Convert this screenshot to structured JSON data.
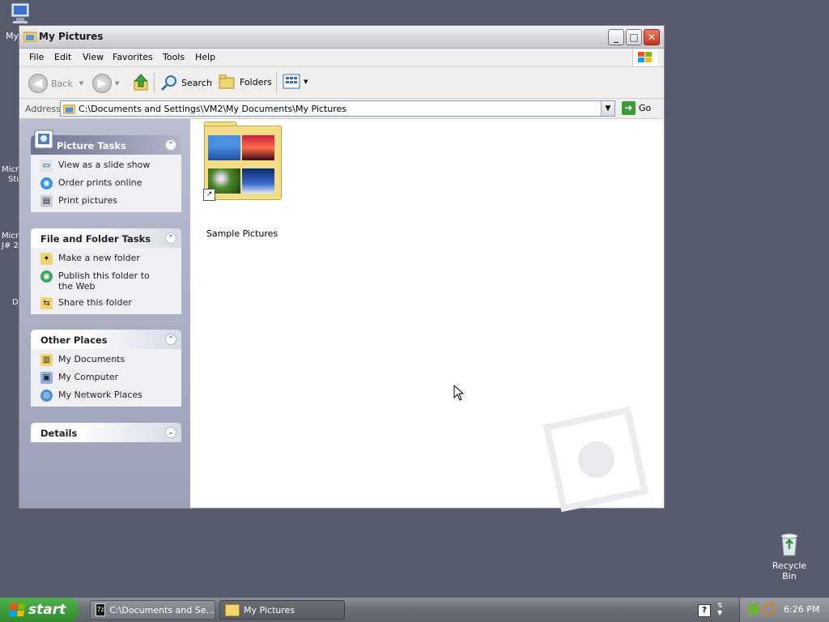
{
  "desktop": {
    "icons": [
      {
        "name": "my-computer",
        "label": "My",
        "icon": "computer-icon"
      },
      {
        "name": "recycle-bin",
        "label": "Recycle Bin",
        "icon": "recycle-bin-icon"
      }
    ],
    "partial_labels": [
      "Micro",
      "Stu",
      "Micro",
      "J# 2",
      "D"
    ]
  },
  "window": {
    "title": "My Pictures",
    "controls": {
      "minimize": "_",
      "maximize": "□",
      "close": "✕"
    },
    "menu": [
      "File",
      "Edit",
      "View",
      "Favorites",
      "Tools",
      "Help"
    ],
    "toolbar": {
      "back": "Back",
      "search": "Search",
      "folders": "Folders"
    },
    "address": {
      "label": "Address",
      "value": "C:\\Documents and Settings\\VM2\\My Documents\\My Pictures",
      "go": "Go"
    },
    "task_pane": {
      "picture_tasks": {
        "title": "Picture Tasks",
        "items": [
          "View as a slide show",
          "Order prints online",
          "Print pictures"
        ]
      },
      "file_folder_tasks": {
        "title": "File and Folder Tasks",
        "items": [
          "Make a new folder",
          "Publish this folder to the Web",
          "Share this folder"
        ]
      },
      "other_places": {
        "title": "Other Places",
        "items": [
          "My Documents",
          "My Computer",
          "My Network Places"
        ]
      },
      "details": {
        "title": "Details"
      }
    },
    "content": {
      "items": [
        {
          "label": "Sample Pictures",
          "icon": "picture-folder-icon"
        }
      ]
    }
  },
  "taskbar": {
    "start": "start",
    "buttons": [
      {
        "label": "C:\\Documents and Se...",
        "icon": "7zip-icon",
        "active": false
      },
      {
        "label": "My Pictures",
        "icon": "folder-icon",
        "active": true
      }
    ],
    "clock": "6:26 PM"
  },
  "colors": {
    "desktop": "#585a6e",
    "start": "#3a9a35",
    "task_pane": "#a6a8bf"
  }
}
